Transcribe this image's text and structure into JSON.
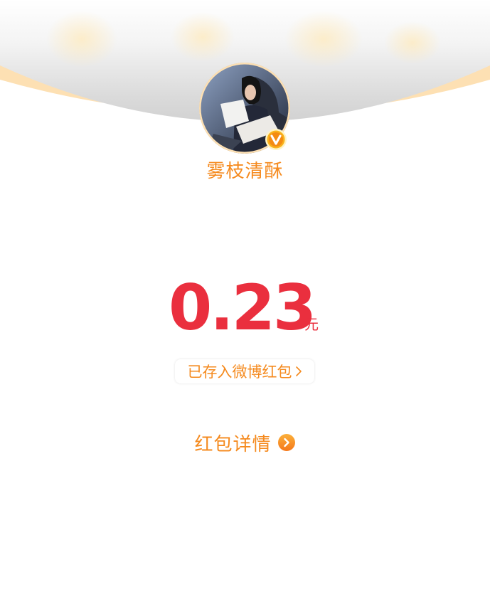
{
  "header": {
    "background": "red-envelope-flap",
    "accent": "#fde2b8"
  },
  "user": {
    "name": "雾枝清酥",
    "badge": "verified-v-icon",
    "avatar": "avatar-image"
  },
  "amount": {
    "value": "0.23",
    "unit": "元",
    "color": "#ea2f3e"
  },
  "saved": {
    "label": "已存入微博红包",
    "icon": "chevron-right-icon"
  },
  "detail": {
    "label": "红包详情",
    "icon": "arrow-circle-icon"
  },
  "colors": {
    "accent": "#f58a1e"
  }
}
